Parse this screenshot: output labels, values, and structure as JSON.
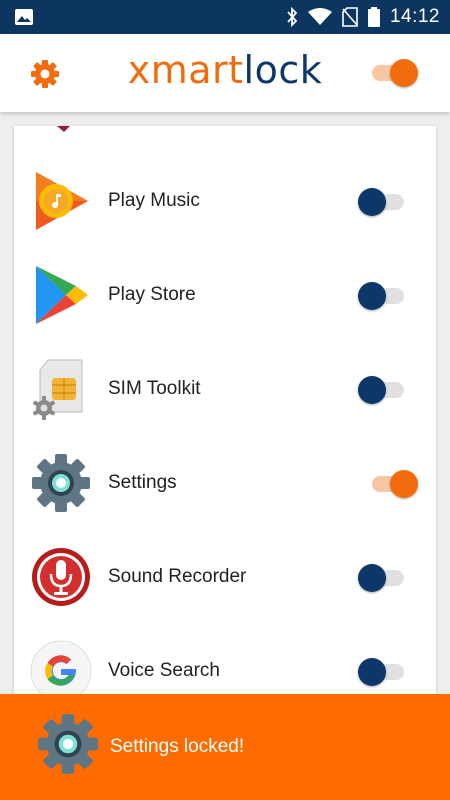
{
  "status_bar": {
    "time": "14:12",
    "icons": [
      "image-icon",
      "bluetooth-icon",
      "wifi-icon",
      "no-sim-icon",
      "battery-icon"
    ]
  },
  "app_bar": {
    "logo_part1": "xmart",
    "logo_part2": "lock",
    "settings_icon": "gear-icon",
    "master_toggle": "on"
  },
  "app_list": [
    {
      "name": "Play Music",
      "icon": "play-music-icon",
      "locked": false
    },
    {
      "name": "Play Store",
      "icon": "play-store-icon",
      "locked": false
    },
    {
      "name": "SIM Toolkit",
      "icon": "sim-toolkit-icon",
      "locked": false
    },
    {
      "name": "Settings",
      "icon": "settings-gear-icon",
      "locked": true
    },
    {
      "name": "Sound Recorder",
      "icon": "sound-recorder-icon",
      "locked": false
    },
    {
      "name": "Voice Search",
      "icon": "google-icon",
      "locked": false
    }
  ],
  "snackbar": {
    "message": "Settings locked!",
    "icon": "settings-gear-icon"
  },
  "colors": {
    "status_bar": "#0c3660",
    "accent": "#f26c0d",
    "brand_dark": "#0d3768",
    "snackbar": "#fe6b00"
  }
}
